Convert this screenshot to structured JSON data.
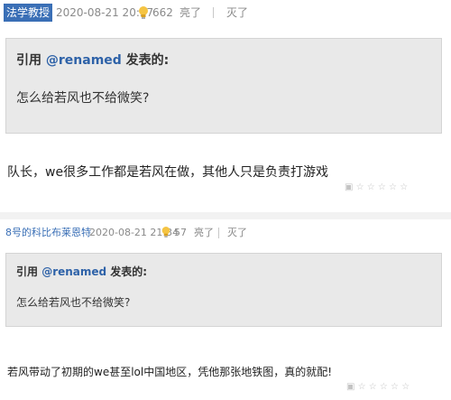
{
  "comments": [
    {
      "username": "法学教授",
      "timestamp": "2020-08-21 20:57",
      "likes": "662",
      "like_label": "亮了",
      "dislike_label": "灭了",
      "quote_prefix": "引用 ",
      "quote_user": "@renamed",
      "quote_suffix": " 发表的:",
      "quote_text": "怎么给若风也不给微笑?",
      "reply_text": "队长，we很多工作都是若风在做，其他人只是负责打游戏"
    },
    {
      "username": "8号的科比布莱恩特",
      "timestamp": "2020-08-21 21:34",
      "likes": "57",
      "like_label": "亮了",
      "dislike_label": "灭了",
      "quote_prefix": "引用 ",
      "quote_user": "@renamed",
      "quote_suffix": " 发表的:",
      "quote_text": "怎么给若风也不给微笑?",
      "reply_text": "若风带动了初期的we甚至lol中国地区，凭他那张地铁图，真的就配!"
    }
  ]
}
